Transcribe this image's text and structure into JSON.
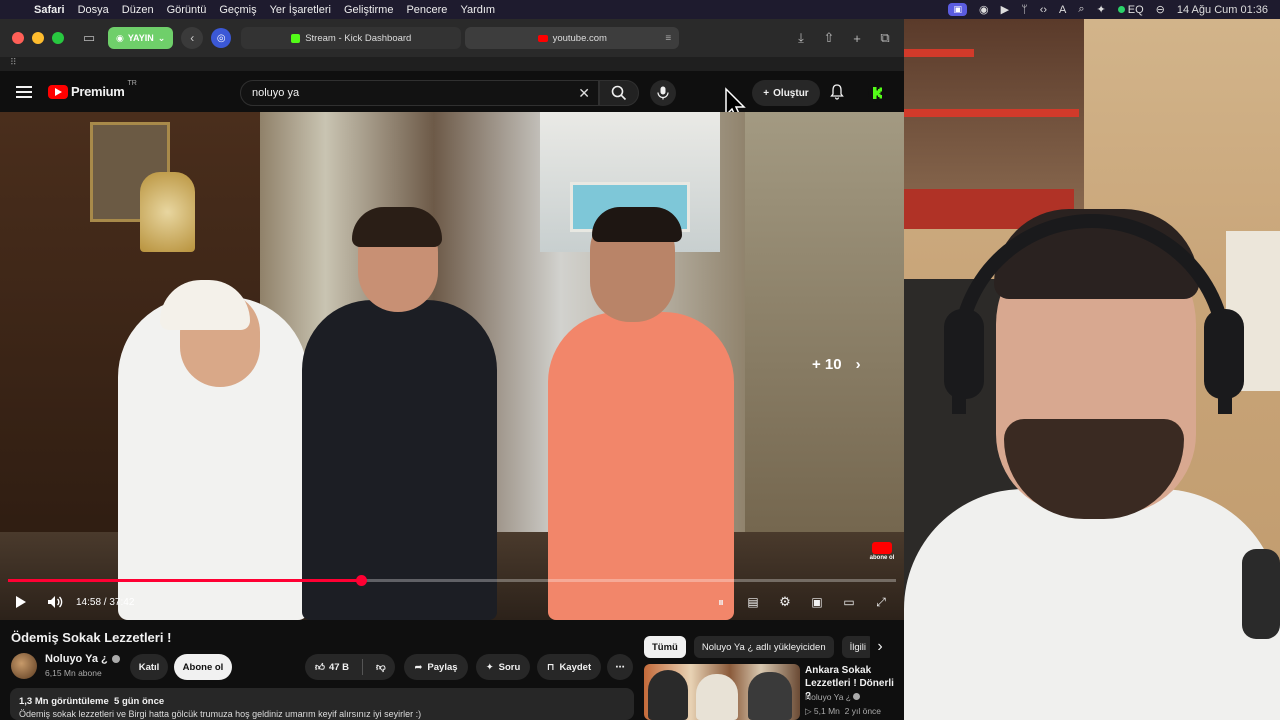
{
  "menubar": {
    "app": "Safari",
    "items": [
      "Dosya",
      "Düzen",
      "Görüntü",
      "Geçmiş",
      "Yer İşaretleri",
      "Geliştirme",
      "Pencere",
      "Yardım"
    ],
    "eq_label": "EQ",
    "datetime": "14 Ağu Cum  01:36"
  },
  "safari": {
    "live_label": "YAYIN",
    "tab1_title": "Stream - Kick Dashboard",
    "tab2_title": "youtube.com"
  },
  "youtube": {
    "logo_text": "Premium",
    "logo_region": "TR",
    "search_value": "noluyo ya",
    "create_label": "Oluştur"
  },
  "player": {
    "next_count": "+ 10",
    "current_time": "14:58",
    "duration": "37:42",
    "time_display": "14:58 / 37:42",
    "progress_fraction": 0.397,
    "abone_badge": "abone ol",
    "progress_color": "#ff0033"
  },
  "video_info": {
    "title": "Ödemiş Sokak Lezzetleri !",
    "channel": "Noluyo Ya ¿",
    "subscribers": "6,15 Mn abone",
    "join_label": "Katıl",
    "subscribe_label": "Abone ol",
    "likes": "47 B",
    "share_label": "Paylaş",
    "ask_label": "Soru",
    "save_label": "Kaydet",
    "views": "1,3 Mn görüntüleme",
    "age": "5 gün önce",
    "description": "Ödemiş sokak lezzetleri ve Birgi hatta gölcük trumuza hoş geldiniz umarım keyif alırsınız iyi seyirler :)"
  },
  "recommendations": {
    "chips": [
      "Tümü",
      "Noluyo Ya ¿ adlı yükleyiciden",
      "İlgili"
    ],
    "items": [
      {
        "title": "Ankara Sokak Lezzetleri ! Dönerli ?",
        "channel": "Noluyo Ya ¿",
        "views": "5,1 Mn",
        "age": "2 yıl önce"
      }
    ]
  }
}
